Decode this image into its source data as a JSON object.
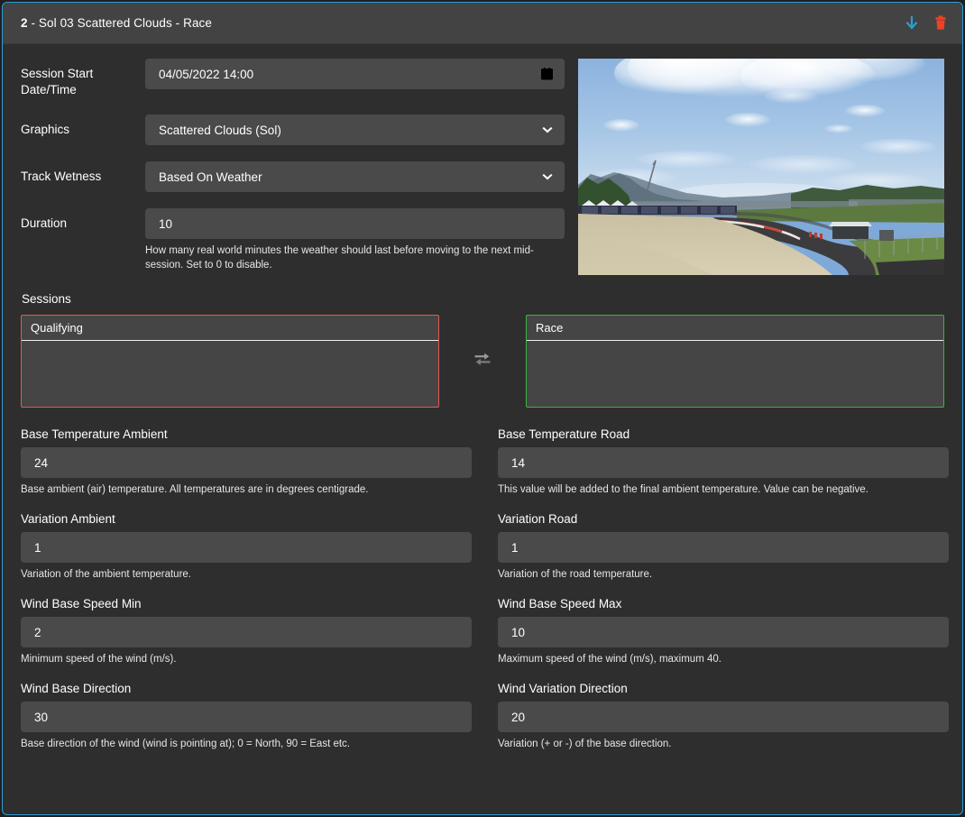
{
  "header": {
    "index": "2",
    "title_rest": " - Sol 03 Scattered Clouds - Race",
    "download_icon": "download-arrow-icon",
    "delete_icon": "trash-icon",
    "accent_color": "#2a9fd6",
    "download_color": "#2a9fd6",
    "delete_color": "#f04124"
  },
  "top_form": {
    "session_start": {
      "label": "Session Start Date/Time",
      "value": "04/05/2022 14:00",
      "icon": "calendar-icon"
    },
    "graphics": {
      "label": "Graphics",
      "value": "Scattered Clouds (Sol)",
      "icon": "chevron-down-icon"
    },
    "track_wetness": {
      "label": "Track Wetness",
      "value": "Based On Weather",
      "icon": "chevron-down-icon"
    },
    "duration": {
      "label": "Duration",
      "value": "10",
      "help": "How many real world minutes the weather should last before moving to the next mid-session. Set to 0 to disable."
    }
  },
  "preview": {
    "alt": "scattered clouds race track preview"
  },
  "sessions": {
    "label": "Sessions",
    "left": {
      "title": "Qualifying",
      "border_color": "#e05c51"
    },
    "right": {
      "title": "Race",
      "border_color": "#3fb33f"
    },
    "swap_icon": "exchange-arrows-icon"
  },
  "fields": [
    {
      "label": "Base Temperature Ambient",
      "value": "24",
      "help": "Base ambient (air) temperature. All temperatures are in degrees centigrade."
    },
    {
      "label": "Base Temperature Road",
      "value": "14",
      "help": "This value will be added to the final ambient temperature. Value can be negative."
    },
    {
      "label": "Variation Ambient",
      "value": "1",
      "help": "Variation of the ambient temperature."
    },
    {
      "label": "Variation Road",
      "value": "1",
      "help": "Variation of the road temperature."
    },
    {
      "label": "Wind Base Speed Min",
      "value": "2",
      "help": "Minimum speed of the wind (m/s)."
    },
    {
      "label": "Wind Base Speed Max",
      "value": "10",
      "help": "Maximum speed of the wind (m/s), maximum 40."
    },
    {
      "label": "Wind Base Direction",
      "value": "30",
      "help": "Base direction of the wind (wind is pointing at); 0 = North, 90 = East etc."
    },
    {
      "label": "Wind Variation Direction",
      "value": "20",
      "help": "Variation (+ or -) of the base direction."
    }
  ]
}
